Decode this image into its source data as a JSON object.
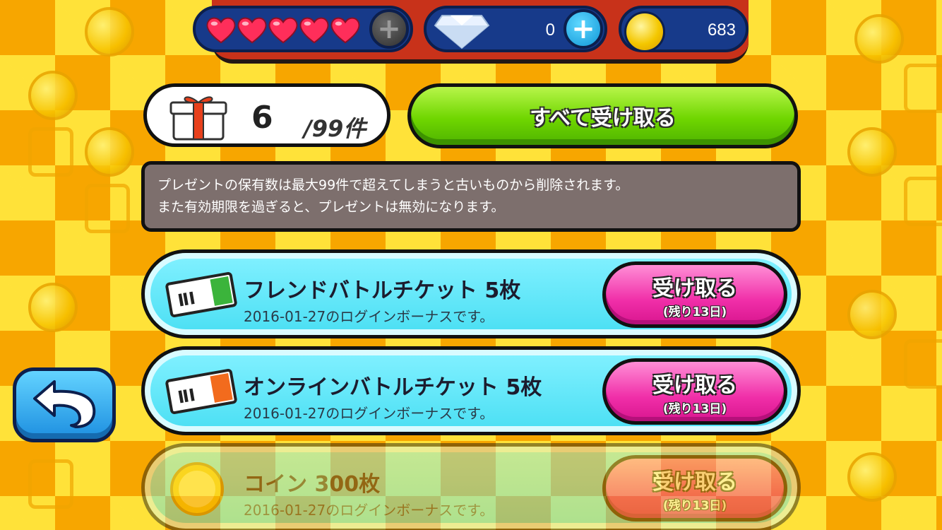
{
  "hud": {
    "hearts_count": 5,
    "gems": "0",
    "coins": "683"
  },
  "gift_counter": {
    "count": "6",
    "max": "/99件"
  },
  "receive_all_label": "すべて受け取る",
  "notice": {
    "line1": "プレゼントの保有数は最大99件で超えてしまうと古いものから削除されます。",
    "line2": "また有効期限を過ぎると、プレゼントは無効になります。"
  },
  "items": [
    {
      "title": "フレンドバトルチケット  5枚",
      "subtitle": "2016-01-27のログインボーナスです。",
      "button": "受け取る",
      "remaining": "(残り13日)",
      "ticket_color": "#3bb43b"
    },
    {
      "title": "オンラインバトルチケット  5枚",
      "subtitle": "2016-01-27のログインボーナスです。",
      "button": "受け取る",
      "remaining": "(残り13日)",
      "ticket_color": "#f26b1d"
    },
    {
      "title": "コイン  300枚",
      "subtitle": "2016-01-27のログインボーナスです。",
      "button": "受け取る",
      "remaining": "(残り13日)"
    }
  ],
  "colors": {
    "heart": "#ff2e5a",
    "receive_all": "#6fd600",
    "receive_button": "#f02ea8",
    "item_bg": "#4ee0f4",
    "hud_bg": "#173a8a"
  }
}
